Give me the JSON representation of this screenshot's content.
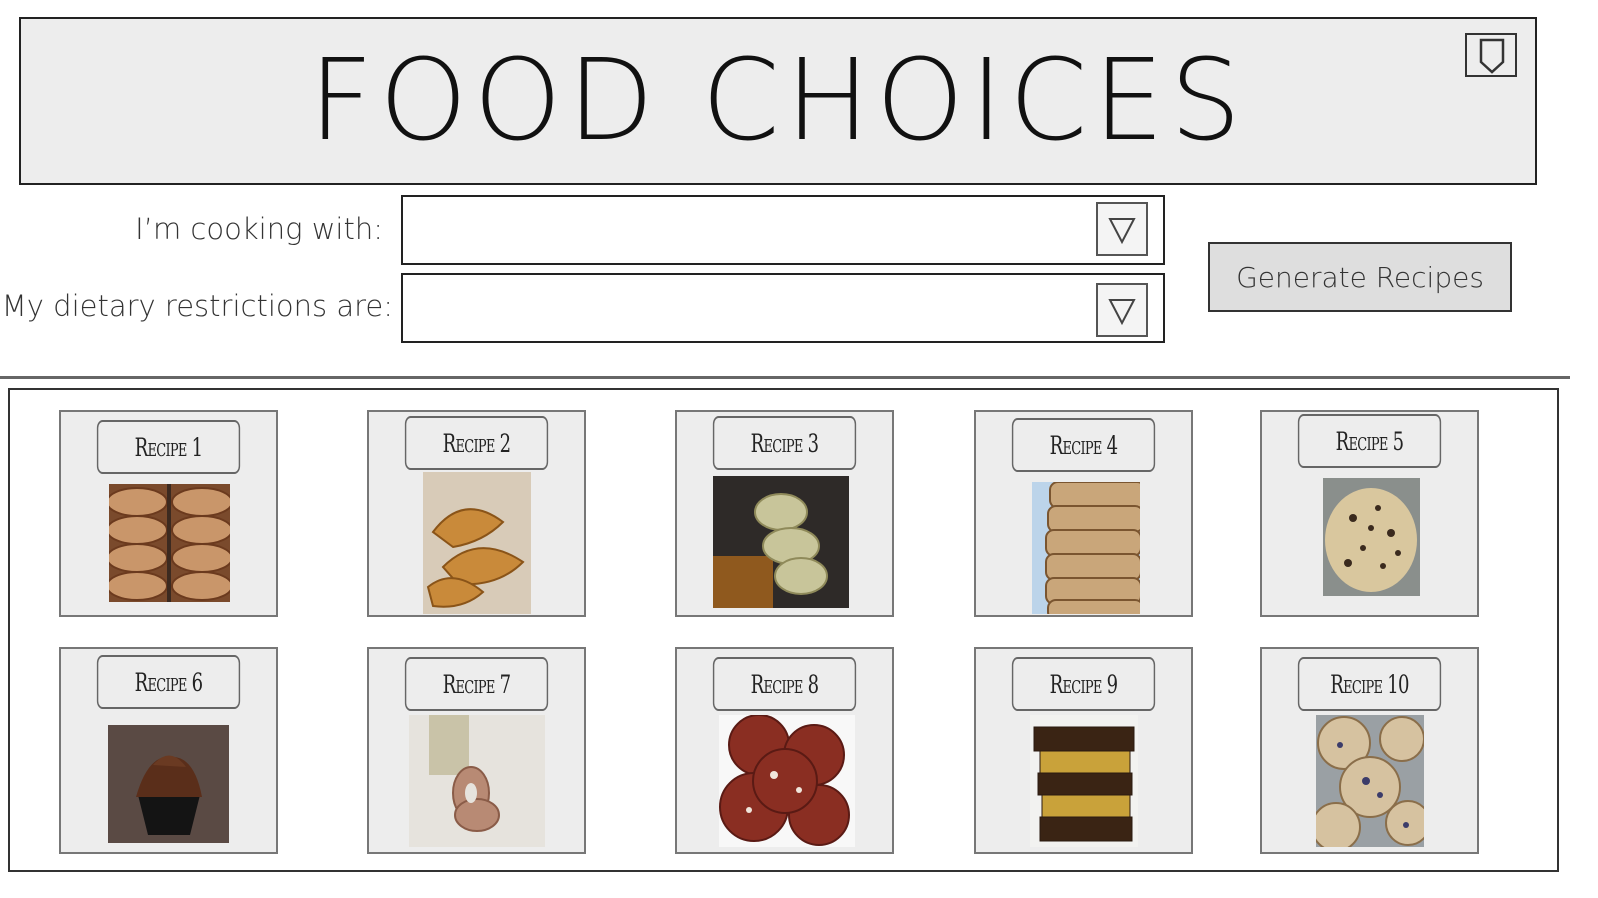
{
  "header": {
    "title": "FOOD CHOICES",
    "bookmark_icon": "bookmark-icon"
  },
  "form": {
    "cooking_with": {
      "label": "I’m cooking with:",
      "value": ""
    },
    "dietary": {
      "label": "My dietary restrictions are:",
      "value": ""
    },
    "generate_label": "Generate Recipes"
  },
  "recipes": [
    {
      "title": "Recipe 1",
      "image": "bagels"
    },
    {
      "title": "Recipe 2",
      "image": "croissants"
    },
    {
      "title": "Recipe 3",
      "image": "biscuits"
    },
    {
      "title": "Recipe 4",
      "image": "bread-slices"
    },
    {
      "title": "Recipe 5",
      "image": "cookie-dough"
    },
    {
      "title": "Recipe 6",
      "image": "chocolate-cupcake"
    },
    {
      "title": "Recipe 7",
      "image": "glazed-donuts"
    },
    {
      "title": "Recipe 8",
      "image": "red-velvet-cookies"
    },
    {
      "title": "Recipe 9",
      "image": "brownie-stack"
    },
    {
      "title": "Recipe 10",
      "image": "blueberry-muffins"
    }
  ],
  "colors": {
    "panel": "#ededed",
    "border": "#222222",
    "button": "#dedede"
  }
}
